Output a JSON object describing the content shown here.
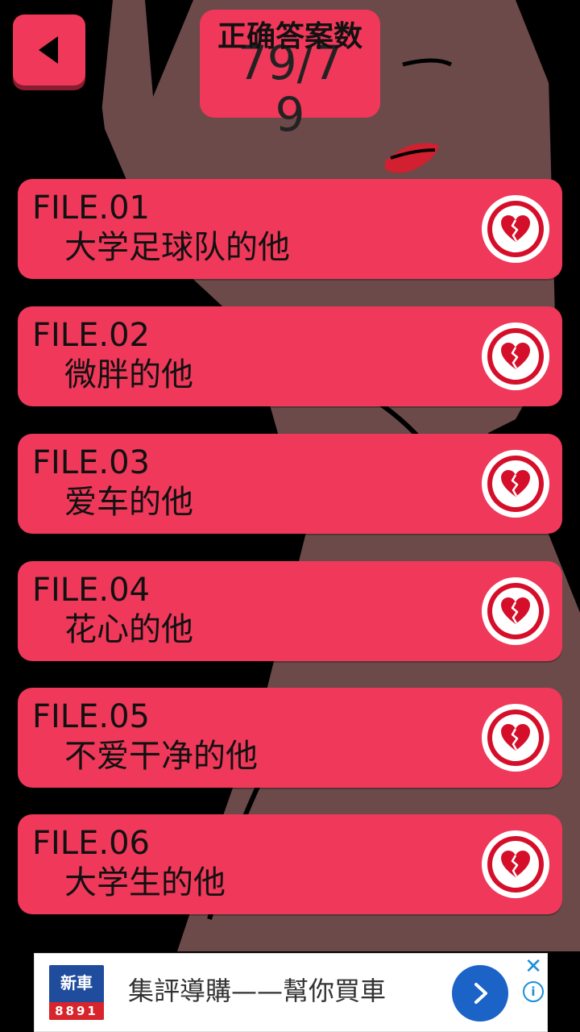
{
  "header": {
    "back_icon": "back-arrow-icon",
    "score_title": "正确答案数",
    "score_value": "79/79"
  },
  "files": [
    {
      "code": "FILE.01",
      "title": "大学足球队的他",
      "icon": "broken-heart-icon"
    },
    {
      "code": "FILE.02",
      "title": "微胖的他",
      "icon": "broken-heart-icon"
    },
    {
      "code": "FILE.03",
      "title": "爱车的他",
      "icon": "broken-heart-icon"
    },
    {
      "code": "FILE.04",
      "title": "花心的他",
      "icon": "broken-heart-icon"
    },
    {
      "code": "FILE.05",
      "title": "不爱干净的他",
      "icon": "broken-heart-icon"
    },
    {
      "code": "FILE.06",
      "title": "大学生的他",
      "icon": "broken-heart-icon"
    }
  ],
  "ad": {
    "logo_top": "新車",
    "logo_bottom": "8891",
    "text": "集評導購——幫你買車",
    "close": "✕",
    "info": "i"
  },
  "colors": {
    "accent": "#f0385a",
    "heart": "#d50f2a",
    "ad_button": "#1b63c6"
  }
}
